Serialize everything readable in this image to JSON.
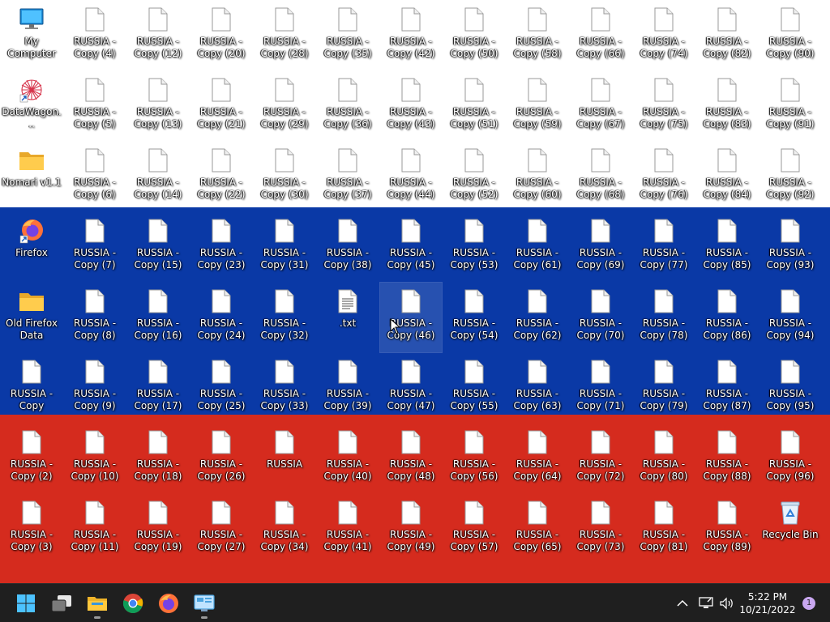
{
  "desktop": {
    "flag_colors": {
      "white": "#ffffff",
      "blue": "#0a39a6",
      "red": "#d52b1e"
    },
    "icons": [
      {
        "label": "My Computer",
        "type": "computer",
        "col": 0,
        "row": 0
      },
      {
        "label": "DataWagon...",
        "type": "datawagon",
        "col": 0,
        "row": 1,
        "shortcut": true
      },
      {
        "label": "Nomari v1.1",
        "type": "folder",
        "col": 0,
        "row": 2
      },
      {
        "label": "Firefox",
        "type": "firefox",
        "col": 0,
        "row": 3,
        "shortcut": true
      },
      {
        "label": "Old Firefox Data",
        "type": "folder",
        "col": 0,
        "row": 4
      },
      {
        "label": "RUSSIA - Copy",
        "type": "file",
        "col": 0,
        "row": 5
      },
      {
        "label": "RUSSIA - Copy (2)",
        "type": "file",
        "col": 0,
        "row": 6
      },
      {
        "label": "RUSSIA - Copy (3)",
        "type": "file",
        "col": 0,
        "row": 7
      },
      {
        "label": "RUSSIA - Copy (4)",
        "type": "file",
        "col": 1,
        "row": 0
      },
      {
        "label": "RUSSIA - Copy (5)",
        "type": "file",
        "col": 1,
        "row": 1
      },
      {
        "label": "RUSSIA - Copy (6)",
        "type": "file",
        "col": 1,
        "row": 2
      },
      {
        "label": "RUSSIA - Copy (7)",
        "type": "file",
        "col": 1,
        "row": 3
      },
      {
        "label": "RUSSIA - Copy (8)",
        "type": "file",
        "col": 1,
        "row": 4
      },
      {
        "label": "RUSSIA - Copy (9)",
        "type": "file",
        "col": 1,
        "row": 5
      },
      {
        "label": "RUSSIA - Copy (10)",
        "type": "file",
        "col": 1,
        "row": 6
      },
      {
        "label": "RUSSIA - Copy (11)",
        "type": "file",
        "col": 1,
        "row": 7
      },
      {
        "label": "RUSSIA - Copy (12)",
        "type": "file",
        "col": 2,
        "row": 0
      },
      {
        "label": "RUSSIA - Copy (13)",
        "type": "file",
        "col": 2,
        "row": 1
      },
      {
        "label": "RUSSIA - Copy (14)",
        "type": "file",
        "col": 2,
        "row": 2
      },
      {
        "label": "RUSSIA - Copy (15)",
        "type": "file",
        "col": 2,
        "row": 3
      },
      {
        "label": "RUSSIA - Copy (16)",
        "type": "file",
        "col": 2,
        "row": 4
      },
      {
        "label": "RUSSIA - Copy (17)",
        "type": "file",
        "col": 2,
        "row": 5
      },
      {
        "label": "RUSSIA - Copy (18)",
        "type": "file",
        "col": 2,
        "row": 6
      },
      {
        "label": "RUSSIA - Copy (19)",
        "type": "file",
        "col": 2,
        "row": 7
      },
      {
        "label": "RUSSIA - Copy (20)",
        "type": "file",
        "col": 3,
        "row": 0
      },
      {
        "label": "RUSSIA - Copy (21)",
        "type": "file",
        "col": 3,
        "row": 1
      },
      {
        "label": "RUSSIA - Copy (22)",
        "type": "file",
        "col": 3,
        "row": 2
      },
      {
        "label": "RUSSIA - Copy (23)",
        "type": "file",
        "col": 3,
        "row": 3
      },
      {
        "label": "RUSSIA - Copy (24)",
        "type": "file",
        "col": 3,
        "row": 4
      },
      {
        "label": "RUSSIA - Copy (25)",
        "type": "file",
        "col": 3,
        "row": 5
      },
      {
        "label": "RUSSIA - Copy (26)",
        "type": "file",
        "col": 3,
        "row": 6
      },
      {
        "label": "RUSSIA - Copy (27)",
        "type": "file",
        "col": 3,
        "row": 7
      },
      {
        "label": "RUSSIA - Copy (28)",
        "type": "file",
        "col": 4,
        "row": 0
      },
      {
        "label": "RUSSIA - Copy (29)",
        "type": "file",
        "col": 4,
        "row": 1
      },
      {
        "label": "RUSSIA - Copy (30)",
        "type": "file",
        "col": 4,
        "row": 2
      },
      {
        "label": "RUSSIA - Copy (31)",
        "type": "file",
        "col": 4,
        "row": 3
      },
      {
        "label": "RUSSIA - Copy (32)",
        "type": "file",
        "col": 4,
        "row": 4
      },
      {
        "label": "RUSSIA - Copy (33)",
        "type": "file",
        "col": 4,
        "row": 5
      },
      {
        "label": "RUSSIA",
        "type": "file",
        "col": 4,
        "row": 6
      },
      {
        "label": "RUSSIA - Copy (34)",
        "type": "file",
        "col": 4,
        "row": 7
      },
      {
        "label": "RUSSIA - Copy (35)",
        "type": "file",
        "col": 5,
        "row": 0
      },
      {
        "label": "RUSSIA - Copy (36)",
        "type": "file",
        "col": 5,
        "row": 1
      },
      {
        "label": "RUSSIA - Copy (37)",
        "type": "file",
        "col": 5,
        "row": 2
      },
      {
        "label": "RUSSIA - Copy (38)",
        "type": "file",
        "col": 5,
        "row": 3
      },
      {
        "label": ".txt",
        "type": "text",
        "col": 5,
        "row": 4
      },
      {
        "label": "RUSSIA - Copy (39)",
        "type": "file",
        "col": 5,
        "row": 5
      },
      {
        "label": "RUSSIA - Copy (40)",
        "type": "file",
        "col": 5,
        "row": 6
      },
      {
        "label": "RUSSIA - Copy (41)",
        "type": "file",
        "col": 5,
        "row": 7
      },
      {
        "label": "RUSSIA - Copy (42)",
        "type": "file",
        "col": 6,
        "row": 0
      },
      {
        "label": "RUSSIA - Copy (43)",
        "type": "file",
        "col": 6,
        "row": 1
      },
      {
        "label": "RUSSIA - Copy (44)",
        "type": "file",
        "col": 6,
        "row": 2
      },
      {
        "label": "RUSSIA - Copy (45)",
        "type": "file",
        "col": 6,
        "row": 3
      },
      {
        "label": "RUSSIA - Copy (46)",
        "type": "file",
        "col": 6,
        "row": 4,
        "selected": true
      },
      {
        "label": "RUSSIA - Copy (47)",
        "type": "file",
        "col": 6,
        "row": 5
      },
      {
        "label": "RUSSIA - Copy (48)",
        "type": "file",
        "col": 6,
        "row": 6
      },
      {
        "label": "RUSSIA - Copy (49)",
        "type": "file",
        "col": 6,
        "row": 7
      },
      {
        "label": "RUSSIA - Copy (50)",
        "type": "file",
        "col": 7,
        "row": 0
      },
      {
        "label": "RUSSIA - Copy (51)",
        "type": "file",
        "col": 7,
        "row": 1
      },
      {
        "label": "RUSSIA - Copy (52)",
        "type": "file",
        "col": 7,
        "row": 2
      },
      {
        "label": "RUSSIA - Copy (53)",
        "type": "file",
        "col": 7,
        "row": 3
      },
      {
        "label": "RUSSIA - Copy (54)",
        "type": "file",
        "col": 7,
        "row": 4
      },
      {
        "label": "RUSSIA - Copy (55)",
        "type": "file",
        "col": 7,
        "row": 5
      },
      {
        "label": "RUSSIA - Copy (56)",
        "type": "file",
        "col": 7,
        "row": 6
      },
      {
        "label": "RUSSIA - Copy (57)",
        "type": "file",
        "col": 7,
        "row": 7
      },
      {
        "label": "RUSSIA - Copy (58)",
        "type": "file",
        "col": 8,
        "row": 0
      },
      {
        "label": "RUSSIA - Copy (59)",
        "type": "file",
        "col": 8,
        "row": 1
      },
      {
        "label": "RUSSIA - Copy (60)",
        "type": "file",
        "col": 8,
        "row": 2
      },
      {
        "label": "RUSSIA - Copy (61)",
        "type": "file",
        "col": 8,
        "row": 3
      },
      {
        "label": "RUSSIA - Copy (62)",
        "type": "file",
        "col": 8,
        "row": 4
      },
      {
        "label": "RUSSIA - Copy (63)",
        "type": "file",
        "col": 8,
        "row": 5
      },
      {
        "label": "RUSSIA - Copy (64)",
        "type": "file",
        "col": 8,
        "row": 6
      },
      {
        "label": "RUSSIA - Copy (65)",
        "type": "file",
        "col": 8,
        "row": 7
      },
      {
        "label": "RUSSIA - Copy (66)",
        "type": "file",
        "col": 9,
        "row": 0
      },
      {
        "label": "RUSSIA - Copy (67)",
        "type": "file",
        "col": 9,
        "row": 1
      },
      {
        "label": "RUSSIA - Copy (68)",
        "type": "file",
        "col": 9,
        "row": 2
      },
      {
        "label": "RUSSIA - Copy (69)",
        "type": "file",
        "col": 9,
        "row": 3
      },
      {
        "label": "RUSSIA - Copy (70)",
        "type": "file",
        "col": 9,
        "row": 4
      },
      {
        "label": "RUSSIA - Copy (71)",
        "type": "file",
        "col": 9,
        "row": 5
      },
      {
        "label": "RUSSIA - Copy (72)",
        "type": "file",
        "col": 9,
        "row": 6
      },
      {
        "label": "RUSSIA - Copy (73)",
        "type": "file",
        "col": 9,
        "row": 7
      },
      {
        "label": "RUSSIA - Copy (74)",
        "type": "file",
        "col": 10,
        "row": 0
      },
      {
        "label": "RUSSIA - Copy (75)",
        "type": "file",
        "col": 10,
        "row": 1
      },
      {
        "label": "RUSSIA - Copy (76)",
        "type": "file",
        "col": 10,
        "row": 2
      },
      {
        "label": "RUSSIA - Copy (77)",
        "type": "file",
        "col": 10,
        "row": 3
      },
      {
        "label": "RUSSIA - Copy (78)",
        "type": "file",
        "col": 10,
        "row": 4
      },
      {
        "label": "RUSSIA - Copy (79)",
        "type": "file",
        "col": 10,
        "row": 5
      },
      {
        "label": "RUSSIA - Copy (80)",
        "type": "file",
        "col": 10,
        "row": 6
      },
      {
        "label": "RUSSIA - Copy (81)",
        "type": "file",
        "col": 10,
        "row": 7
      },
      {
        "label": "RUSSIA - Copy (82)",
        "type": "file",
        "col": 11,
        "row": 0
      },
      {
        "label": "RUSSIA - Copy (83)",
        "type": "file",
        "col": 11,
        "row": 1
      },
      {
        "label": "RUSSIA - Copy (84)",
        "type": "file",
        "col": 11,
        "row": 2
      },
      {
        "label": "RUSSIA - Copy (85)",
        "type": "file",
        "col": 11,
        "row": 3
      },
      {
        "label": "RUSSIA - Copy (86)",
        "type": "file",
        "col": 11,
        "row": 4
      },
      {
        "label": "RUSSIA - Copy (87)",
        "type": "file",
        "col": 11,
        "row": 5
      },
      {
        "label": "RUSSIA - Copy (88)",
        "type": "file",
        "col": 11,
        "row": 6
      },
      {
        "label": "RUSSIA - Copy (89)",
        "type": "file",
        "col": 11,
        "row": 7
      },
      {
        "label": "RUSSIA - Copy (90)",
        "type": "file",
        "col": 12,
        "row": 0
      },
      {
        "label": "RUSSIA - Copy (91)",
        "type": "file",
        "col": 12,
        "row": 1
      },
      {
        "label": "RUSSIA - Copy (92)",
        "type": "file",
        "col": 12,
        "row": 2
      },
      {
        "label": "RUSSIA - Copy (93)",
        "type": "file",
        "col": 12,
        "row": 3
      },
      {
        "label": "RUSSIA - Copy (94)",
        "type": "file",
        "col": 12,
        "row": 4
      },
      {
        "label": "RUSSIA - Copy (95)",
        "type": "file",
        "col": 12,
        "row": 5
      },
      {
        "label": "RUSSIA - Copy (96)",
        "type": "file",
        "col": 12,
        "row": 6
      },
      {
        "label": "Recycle Bin",
        "type": "recycle",
        "col": 12,
        "row": 7
      }
    ]
  },
  "taskbar": {
    "apps": [
      {
        "name": "start",
        "icon": "windows-logo-icon",
        "running": false
      },
      {
        "name": "task-view",
        "icon": "task-view-icon",
        "running": false
      },
      {
        "name": "file-explorer",
        "icon": "folder-icon",
        "running": true
      },
      {
        "name": "chrome",
        "icon": "chrome-icon",
        "running": false
      },
      {
        "name": "firefox",
        "icon": "firefox-icon",
        "running": false
      },
      {
        "name": "control-panel",
        "icon": "control-panel-icon",
        "running": true
      }
    ],
    "tray_icons": [
      "chevron-up-icon",
      "network-icon",
      "speaker-icon"
    ],
    "clock": {
      "time": "5:22 PM",
      "date": "10/21/2022"
    },
    "notification_count": "1"
  }
}
